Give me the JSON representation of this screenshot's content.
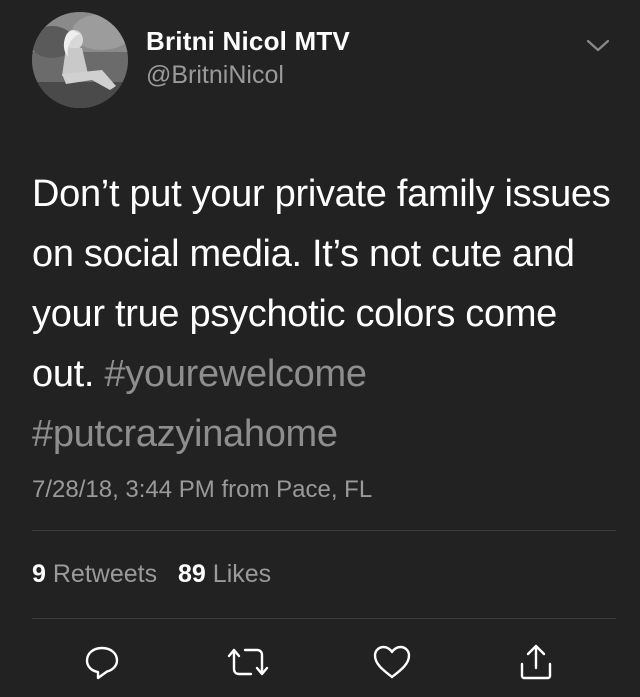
{
  "user": {
    "display_name": "Britni Nicol MTV",
    "handle": "@BritniNicol"
  },
  "tweet": {
    "text_segments": [
      "Don’t put your private family issues on social media. It’s not cute and your true psychotic colors come out. ",
      "#yourewelcome",
      " ",
      "#putcrazyinahome"
    ],
    "timestamp": "7/28/18, 3:44 PM",
    "from_label": "from",
    "location": "Pace, FL"
  },
  "stats": {
    "retweets_count": "9",
    "retweets_label": "Retweets",
    "likes_count": "89",
    "likes_label": "Likes"
  },
  "icons": {
    "menu": "chevron-down-icon",
    "reply": "reply-icon",
    "retweet": "retweet-icon",
    "like": "heart-icon",
    "share": "share-icon"
  },
  "colors": {
    "background": "#222222",
    "text": "#ffffff",
    "secondary": "#9a9a9a",
    "hashtag": "#8e8e8e",
    "divider": "#3c3c3c"
  }
}
